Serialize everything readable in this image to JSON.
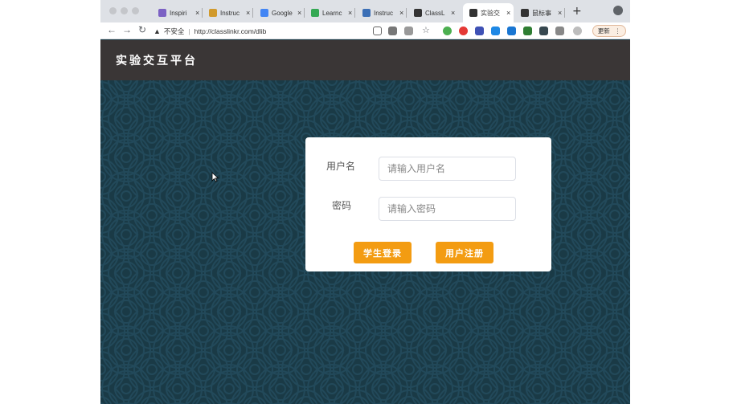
{
  "browser": {
    "tabs": [
      {
        "title": "Inspiri",
        "icon": "y-icon",
        "color": "#7b61c4"
      },
      {
        "title": "Instruc",
        "icon": "person-icon",
        "color": "#d19a2c"
      },
      {
        "title": "Google",
        "icon": "docs-icon",
        "color": "#4285f4"
      },
      {
        "title": "Learnc",
        "icon": "puzzle-icon",
        "color": "#34a853"
      },
      {
        "title": "Instruc",
        "icon": "building-icon",
        "color": "#3b6fb6"
      },
      {
        "title": "ClassL",
        "icon": "globe-icon",
        "color": "#333333"
      },
      {
        "title": "实验交",
        "icon": "globe-icon",
        "color": "#333333"
      },
      {
        "title": "鼠标事",
        "icon": "globe-icon",
        "color": "#333333"
      }
    ],
    "close_glyph": "×",
    "new_tab": "+",
    "security_warning": "不安全",
    "url": "http://classlinkr.com/dlib",
    "update_button": "更新"
  },
  "app": {
    "title": "实验交互平台"
  },
  "login": {
    "username_label": "用户名",
    "username_placeholder": "请输入用户名",
    "password_label": "密码",
    "password_placeholder": "请输入密码",
    "student_login_button": "学生登录",
    "register_button": "用户注册"
  },
  "colors": {
    "accent": "#f39c12",
    "header": "#3a3636",
    "background": "#1a3a46"
  }
}
